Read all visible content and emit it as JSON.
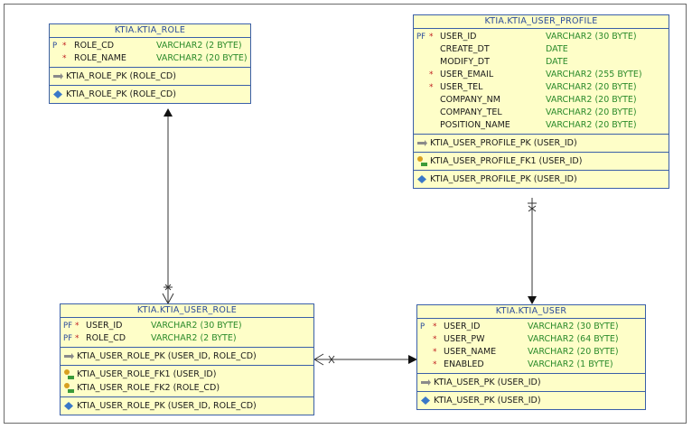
{
  "entities": {
    "role": {
      "title": "KTIA.KTIA_ROLE",
      "columns": [
        {
          "key": "P",
          "required": "*",
          "name": "ROLE_CD",
          "type": "VARCHAR2 (2 BYTE)"
        },
        {
          "key": "",
          "required": "*",
          "name": "ROLE_NAME",
          "type": "VARCHAR2 (20 BYTE)"
        }
      ],
      "keys": [
        {
          "icon": "pk-key-icon",
          "label": "KTIA_ROLE_PK (ROLE_CD)"
        }
      ],
      "indexes": [
        {
          "icon": "index-icon",
          "label": "KTIA_ROLE_PK (ROLE_CD)"
        }
      ]
    },
    "user_profile": {
      "title": "KTIA.KTIA_USER_PROFILE",
      "columns": [
        {
          "key": "PF",
          "required": "*",
          "name": "USER_ID",
          "type": "VARCHAR2 (30 BYTE)"
        },
        {
          "key": "",
          "required": "",
          "name": "CREATE_DT",
          "type": "DATE"
        },
        {
          "key": "",
          "required": "",
          "name": "MODIFY_DT",
          "type": "DATE"
        },
        {
          "key": "",
          "required": "*",
          "name": "USER_EMAIL",
          "type": "VARCHAR2 (255 BYTE)"
        },
        {
          "key": "",
          "required": "*",
          "name": "USER_TEL",
          "type": "VARCHAR2 (20 BYTE)"
        },
        {
          "key": "",
          "required": "",
          "name": "COMPANY_NM",
          "type": "VARCHAR2 (20 BYTE)"
        },
        {
          "key": "",
          "required": "",
          "name": "COMPANY_TEL",
          "type": "VARCHAR2 (20 BYTE)"
        },
        {
          "key": "",
          "required": "",
          "name": "POSITION_NAME",
          "type": "VARCHAR2 (20 BYTE)"
        }
      ],
      "keys": [
        {
          "icon": "pk-key-icon",
          "label": "KTIA_USER_PROFILE_PK (USER_ID)"
        }
      ],
      "foreign_keys": [
        {
          "icon": "fk-key-icon",
          "label": "KTIA_USER_PROFILE_FK1 (USER_ID)"
        }
      ],
      "indexes": [
        {
          "icon": "index-icon",
          "label": "KTIA_USER_PROFILE_PK (USER_ID)"
        }
      ]
    },
    "user_role": {
      "title": "KTIA.KTIA_USER_ROLE",
      "columns": [
        {
          "key": "PF",
          "required": "*",
          "name": "USER_ID",
          "type": "VARCHAR2 (30 BYTE)"
        },
        {
          "key": "PF",
          "required": "*",
          "name": "ROLE_CD",
          "type": "VARCHAR2 (2 BYTE)"
        }
      ],
      "keys": [
        {
          "icon": "pk-key-icon",
          "label": "KTIA_USER_ROLE_PK (USER_ID, ROLE_CD)"
        }
      ],
      "foreign_keys": [
        {
          "icon": "fk-key-icon",
          "label": "KTIA_USER_ROLE_FK1 (USER_ID)"
        },
        {
          "icon": "fk-key-icon",
          "label": "KTIA_USER_ROLE_FK2 (ROLE_CD)"
        }
      ],
      "indexes": [
        {
          "icon": "index-icon",
          "label": "KTIA_USER_ROLE_PK (USER_ID, ROLE_CD)"
        }
      ]
    },
    "user": {
      "title": "KTIA.KTIA_USER",
      "columns": [
        {
          "key": "P",
          "required": "*",
          "name": "USER_ID",
          "type": "VARCHAR2 (30 BYTE)"
        },
        {
          "key": "",
          "required": "*",
          "name": "USER_PW",
          "type": "VARCHAR2 (64 BYTE)"
        },
        {
          "key": "",
          "required": "*",
          "name": "USER_NAME",
          "type": "VARCHAR2 (20 BYTE)"
        },
        {
          "key": "",
          "required": "*",
          "name": "ENABLED",
          "type": "VARCHAR2 (1 BYTE)"
        }
      ],
      "keys": [
        {
          "icon": "pk-key-icon",
          "label": "KTIA_USER_PK (USER_ID)"
        }
      ],
      "indexes": [
        {
          "icon": "index-icon",
          "label": "KTIA_USER_PK (USER_ID)"
        }
      ]
    }
  },
  "colors": {
    "entity_fill": "#fefec8",
    "entity_border": "#3a5fa8",
    "title_text": "#2a4a9a",
    "type_text": "#2a8a2a",
    "required_marker": "#c02020",
    "connector": "#333333"
  }
}
